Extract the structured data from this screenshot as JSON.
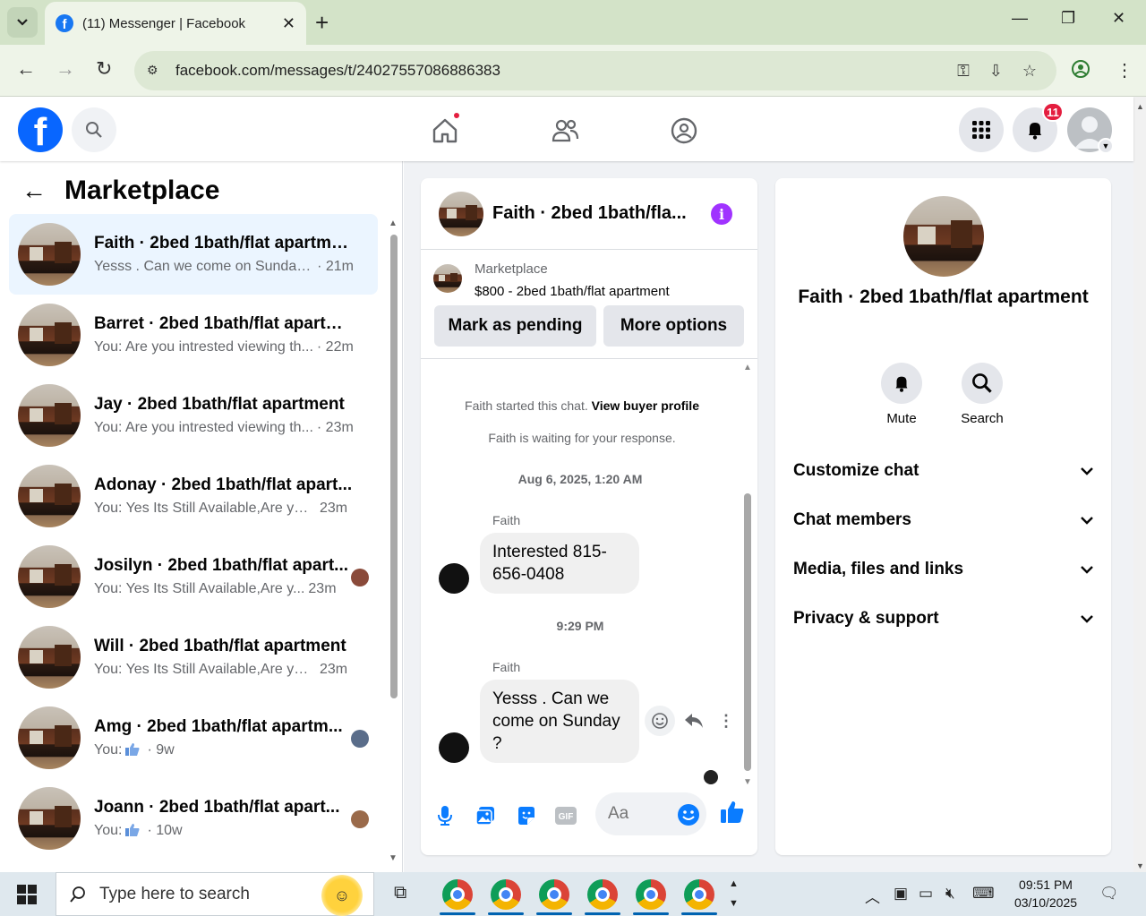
{
  "browser": {
    "tab_title": "(11) Messenger | Facebook",
    "url": "facebook.com/messages/t/24027557086886383"
  },
  "header": {
    "notification_count": "11"
  },
  "left": {
    "title": "Marketplace",
    "conversations": [
      {
        "name": "Faith · 2bed 1bath/flat apartment",
        "snippet": "Yesss . Can we come on Sunday ?",
        "time": "· 21m",
        "active": true
      },
      {
        "name": "Barret · 2bed 1bath/flat apartment",
        "snippet": "You: Are you intrested viewing th...",
        "time": "· 22m"
      },
      {
        "name": "Jay · 2bed 1bath/flat apartment",
        "snippet": "You: Are you intrested viewing th...",
        "time": "· 23m"
      },
      {
        "name": "Adonay · 2bed 1bath/flat apart...",
        "snippet": "You: Yes Its Still Available,Are you ...",
        "time": "23m"
      },
      {
        "name": "Josilyn · 2bed 1bath/flat apart...",
        "snippet": "You: Yes Its Still Available,Are y...",
        "time": "23m"
      },
      {
        "name": "Will · 2bed 1bath/flat apartment",
        "snippet": "You: Yes Its Still Available,Are you ...",
        "time": "23m"
      },
      {
        "name": "Amg · 2bed 1bath/flat apartm...",
        "snippet": "You:",
        "time": "· 9w"
      },
      {
        "name": "Joann · 2bed 1bath/flat apart...",
        "snippet": "You:",
        "time": "· 10w"
      }
    ]
  },
  "chat": {
    "title": "Faith · 2bed 1bath/fla...",
    "listing_type": "Marketplace",
    "listing_title": "$800 - 2bed 1bath/flat apartment",
    "mark_pending_label": "Mark as pending",
    "more_options_label": "More options",
    "started_text": "Faith started this chat.",
    "view_profile_label": "View buyer profile",
    "waiting_text": "Faith is waiting for your response.",
    "stamp1": "Aug 6, 2025, 1:20 AM",
    "sender1": "Faith",
    "msg1": "Interested 815-656-0408",
    "stamp2": "9:29 PM",
    "sender2": "Faith",
    "msg2": "Yesss . Can we come on Sunday ?",
    "composer_placeholder": "Aa"
  },
  "info": {
    "name": "Faith · 2bed 1bath/flat apartment",
    "mute_label": "Mute",
    "search_label": "Search",
    "sections": [
      "Customize chat",
      "Chat members",
      "Media, files and links",
      "Privacy & support"
    ]
  },
  "taskbar": {
    "search_placeholder": "Type here to search",
    "time": "09:51 PM",
    "date": "03/10/2025"
  },
  "colors": {
    "fb_blue": "#0866ff",
    "messenger_blue": "#0a7cff",
    "info_purple": "#a033ff",
    "badge_red": "#e41e3f"
  }
}
